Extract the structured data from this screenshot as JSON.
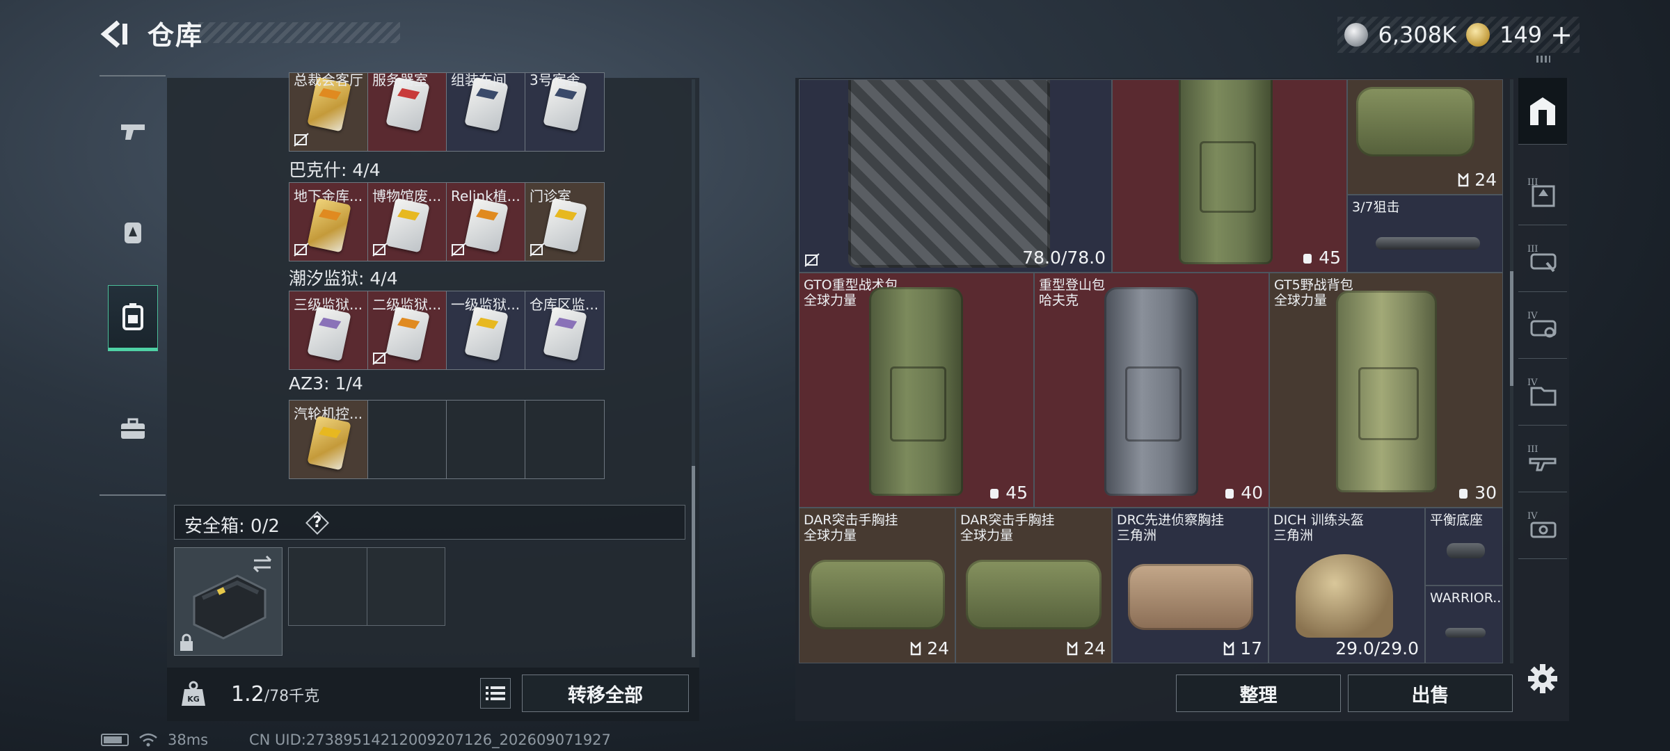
{
  "header": {
    "title": "仓库",
    "currency_silver": "6,308K",
    "currency_gold": "149",
    "plus_label": "+"
  },
  "left_rail": {
    "items": [
      {
        "icon": "pistol-icon",
        "active": false
      },
      {
        "icon": "backpack-badge-icon",
        "active": false
      },
      {
        "icon": "container-icon",
        "active": true
      },
      {
        "icon": "briefcase-icon",
        "active": false
      }
    ]
  },
  "keys": {
    "row0": [
      "总裁会客厅",
      "服务器室",
      "组装车间",
      "3号宿舍"
    ],
    "group1": {
      "label": "巴克什: 4/4",
      "items": [
        "地下金库...",
        "博物馆废...",
        "Relink植...",
        "门诊室"
      ]
    },
    "group2": {
      "label": "潮汐监狱: 4/4",
      "items": [
        "三级监狱...",
        "二级监狱...",
        "一级监狱...",
        "仓库区监..."
      ]
    },
    "group3": {
      "label": "AZ3: 1/4",
      "items": [
        "汽轮机控..."
      ]
    }
  },
  "safe_box": {
    "label": "安全箱: 0/2",
    "help": "?"
  },
  "footer_left": {
    "weight_current": "1.2",
    "weight_max": "/78千克",
    "transfer_label": "转移全部"
  },
  "inventory": {
    "vest_durability": "78.0/78.0",
    "backpack_top_cap": "45",
    "duffel_top_cap": "24",
    "scope_name": "3/7狙击",
    "items_row2": [
      {
        "name": "GTO重型战术包",
        "origin": "全球力量",
        "cap": "45"
      },
      {
        "name": "重型登山包",
        "origin": "哈夫克",
        "cap": "40"
      },
      {
        "name": "GT5野战背包",
        "origin": "全球力量",
        "cap": "30"
      }
    ],
    "items_row3": [
      {
        "name": "DAR突击手胸挂",
        "origin": "全球力量",
        "cap": "24"
      },
      {
        "name": "DAR突击手胸挂",
        "origin": "全球力量",
        "cap": "24"
      },
      {
        "name": "DRC先进侦察胸挂",
        "origin": "三角洲",
        "cap": "17"
      },
      {
        "name": "DICH 训练头盔",
        "origin": "三角洲",
        "durability": "29.0/29.0"
      }
    ],
    "small_item1": "平衡底座",
    "small_item2": "WARRIOR...",
    "sort_label": "整理",
    "sell_label": "出售"
  },
  "right_tabs": [
    "home-icon",
    "tier3-armor-icon",
    "tier3-rig-icon",
    "tier4-rig-icon",
    "tier4-folder-icon",
    "tier3-weapon-icon",
    "tier4-case-icon"
  ],
  "status_bar": {
    "ping": "38ms",
    "uid": "CN UID:2738951421200920​7126_202609071927"
  },
  "colors": {
    "accent": "#4fd1a5",
    "slot_red": "#5a2a30",
    "slot_blue": "#2c3043",
    "slot_brown": "#473a31"
  }
}
